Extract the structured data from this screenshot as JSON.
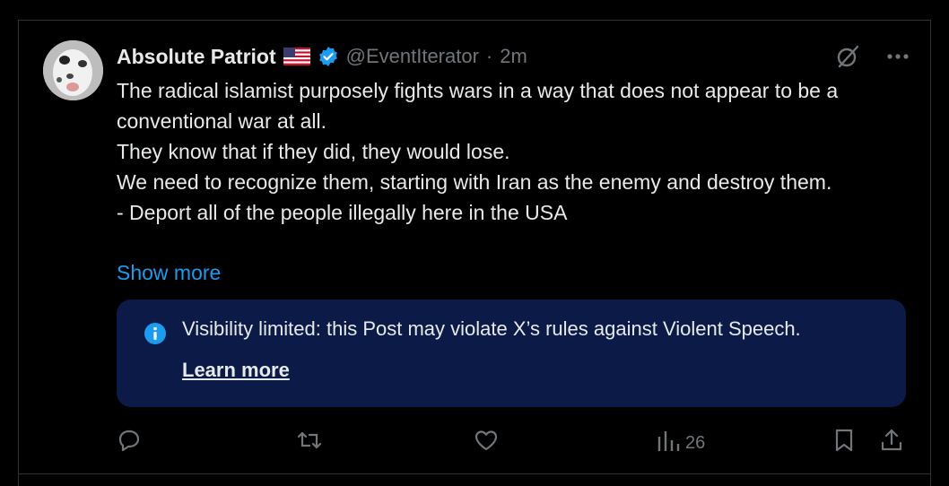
{
  "post": {
    "author_name": "Absolute Patriot",
    "handle": "@EventIterator",
    "separator": "·",
    "time": "2m",
    "lines": [
      "The radical islamist purposely fights wars in a way that does not appear to be a conventional war at all.",
      "They know that if they did, they would lose.",
      "We need to recognize them, starting with Iran as the enemy and destroy them.",
      "- Deport all of the people illegally here in the USA"
    ],
    "show_more": "Show more"
  },
  "notice": {
    "text": "Visibility limited: this Post may violate X’s rules against Violent Speech.",
    "link": "Learn more"
  },
  "actions": {
    "views": "26"
  },
  "colors": {
    "background": "#000000",
    "text": "#e7e9ea",
    "muted": "#71767b",
    "accent": "#1d9bf0",
    "notice_bg": "#0b1a46",
    "border": "#2f3336"
  },
  "icons": [
    "flag-icon",
    "verified-badge-icon",
    "grok-icon",
    "more-icon",
    "info-icon",
    "reply-icon",
    "repost-icon",
    "like-icon",
    "views-icon",
    "bookmark-icon",
    "share-icon"
  ]
}
